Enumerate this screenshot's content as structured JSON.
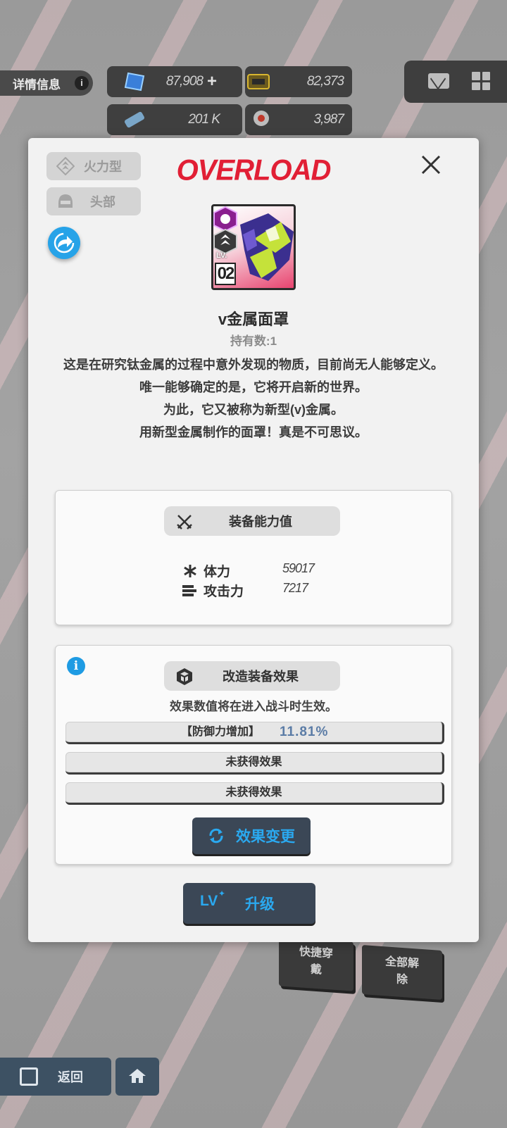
{
  "background": {
    "detail_label": "详情信息",
    "currencies": [
      {
        "icon": "crystal-icon",
        "value": "87,908"
      },
      {
        "icon": "credit-card-icon",
        "value": "82,373"
      },
      {
        "icon": "battery-icon",
        "value": "201 K"
      },
      {
        "icon": "core-dust-icon",
        "value": "3,987"
      }
    ],
    "quick_equip": "快捷穿戴",
    "unequip_all": "全部解除",
    "back": "返回"
  },
  "modal": {
    "tags": [
      {
        "icon": "firepower-type-icon",
        "label": "火力型"
      },
      {
        "icon": "head-slot-icon",
        "label": "头部"
      }
    ],
    "banner": "OVERLOAD",
    "item": {
      "level_prefix": "LV.",
      "level": "02",
      "name": "v金属面罩",
      "owned": "持有数:1"
    },
    "description": [
      "这是在研究钛金属的过程中意外发现的物质，目前尚无人能够定义。",
      "唯一能够确定的是，它将开启新的世界。",
      "为此，它又被称为新型(v)金属。",
      "用新型金属制作的面罩！真是不可思议。"
    ],
    "stats_panel": {
      "title": "装备能力值",
      "stats": [
        {
          "icon": "hp-icon",
          "name": "体力",
          "value": "59017"
        },
        {
          "icon": "attack-icon",
          "name": "攻击力",
          "value": "7217"
        }
      ]
    },
    "effects_panel": {
      "title": "改造装备效果",
      "note": "效果数值将在进入战斗时生效。",
      "effects": [
        {
          "name": "【防御力增加】",
          "value": "11.81%"
        },
        {
          "name": "未获得效果",
          "value": ""
        },
        {
          "name": "未获得效果",
          "value": ""
        }
      ],
      "change_button": "效果变更"
    },
    "upgrade_button": {
      "prefix": "LV",
      "label": "升级"
    }
  },
  "colors": {
    "accent": "#27a3e8",
    "banner": "#e11f35",
    "button_bg": "#3b4756"
  }
}
